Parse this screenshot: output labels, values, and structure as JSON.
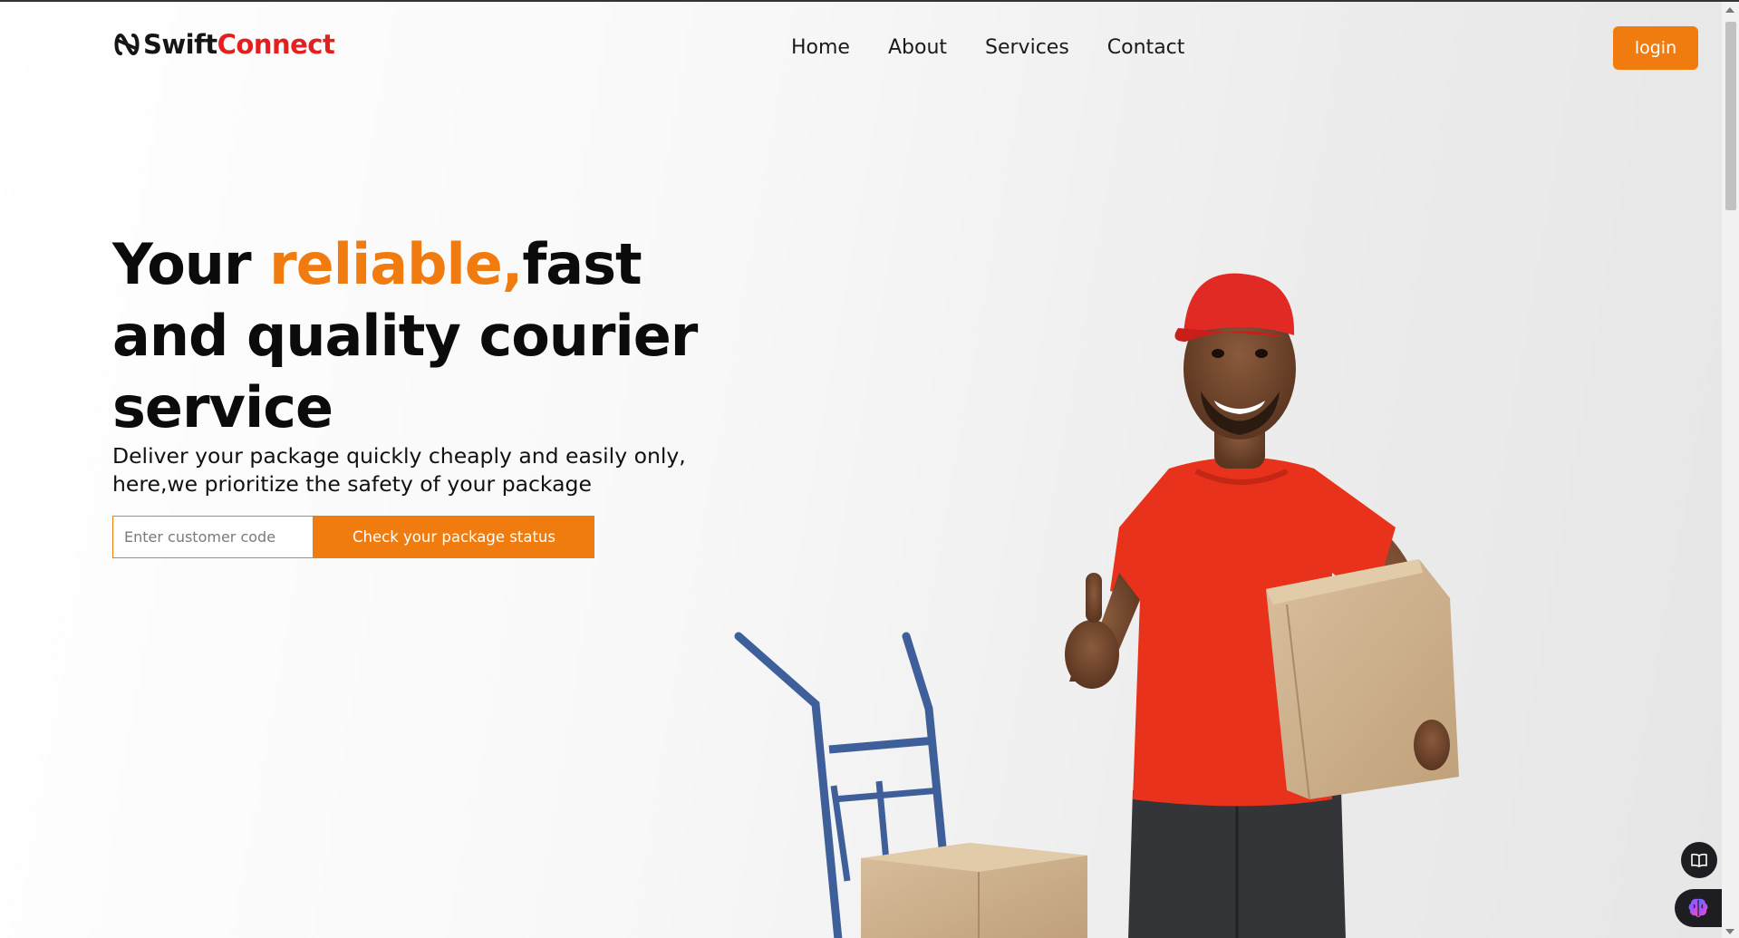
{
  "brand": {
    "name_part1": "Swift",
    "name_part2": "Connect",
    "icon": "logo-link-icon",
    "colors": {
      "dark": "#151515",
      "red": "#e41f1f"
    }
  },
  "nav": {
    "items": [
      {
        "label": "Home"
      },
      {
        "label": "About"
      },
      {
        "label": "Services"
      },
      {
        "label": "Contact"
      }
    ],
    "login_label": "login"
  },
  "hero": {
    "title_part1": "Your ",
    "title_accent": "reliable,",
    "title_part2": "fast",
    "title_line2": "and quality courier",
    "title_line3": "service",
    "subtitle_line1": "Deliver your package quickly cheaply and easily only,",
    "subtitle_line2": "here,we prioritize the safety of your package"
  },
  "tracking": {
    "input_placeholder": "Enter customer code",
    "input_value": "",
    "button_label": "Check your package status"
  },
  "illustration": {
    "description_icon": "courier-photo",
    "elements": [
      "hand-truck",
      "delivery-man",
      "cardboard-box"
    ]
  },
  "widgets": {
    "reader_icon": "book-icon",
    "assistant_icon": "brain-icon"
  },
  "colors": {
    "accent": "#f07c0f",
    "text": "#0b0b0b",
    "shirt": "#e8321c",
    "cap": "#e22a25",
    "box": "#c9ab85",
    "trolley": "#3f5f9a"
  }
}
